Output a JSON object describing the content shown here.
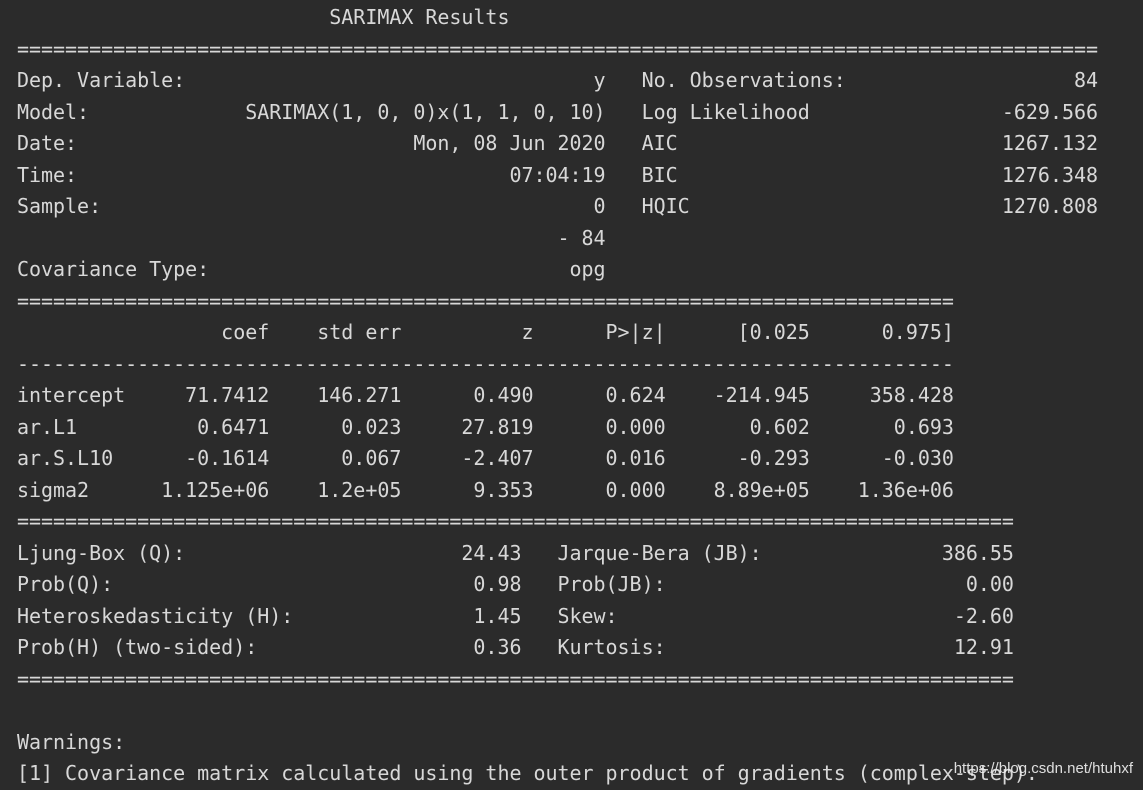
{
  "title": "SARIMAX Results",
  "lines": [
    "                          SARIMAX Results                                       ",
    "==========================================================================================",
    "Dep. Variable:                                  y   No. Observations:                   84",
    "Model:             SARIMAX(1, 0, 0)x(1, 1, 0, 10)   Log Likelihood                -629.566",
    "Date:                            Mon, 08 Jun 2020   AIC                           1267.132",
    "Time:                                    07:04:19   BIC                           1276.348",
    "Sample:                                         0   HQIC                          1270.808",
    "                                             - 84                                         ",
    "Covariance Type:                              opg                                         ",
    "==============================================================================",
    "                 coef    std err          z      P>|z|      [0.025      0.975]",
    "------------------------------------------------------------------------------",
    "intercept     71.7412    146.271      0.490      0.624    -214.945     358.428",
    "ar.L1          0.6471      0.023     27.819      0.000       0.602       0.693",
    "ar.S.L10      -0.1614      0.067     -2.407      0.016      -0.293      -0.030",
    "sigma2      1.125e+06    1.2e+05      9.353      0.000    8.89e+05    1.36e+06",
    "===================================================================================",
    "Ljung-Box (Q):                       24.43   Jarque-Bera (JB):               386.55",
    "Prob(Q):                              0.98   Prob(JB):                         0.00",
    "Heteroskedasticity (H):               1.45   Skew:                            -2.60",
    "Prob(H) (two-sided):                  0.36   Kurtosis:                        12.91",
    "===================================================================================",
    "",
    "Warnings:",
    "[1] Covariance matrix calculated using the outer product of gradients (complex-step)."
  ],
  "watermark": "https://blog.csdn.net/htuhxf",
  "colors": {
    "background": "#2b2b2b",
    "text": "#d8d8d8"
  }
}
